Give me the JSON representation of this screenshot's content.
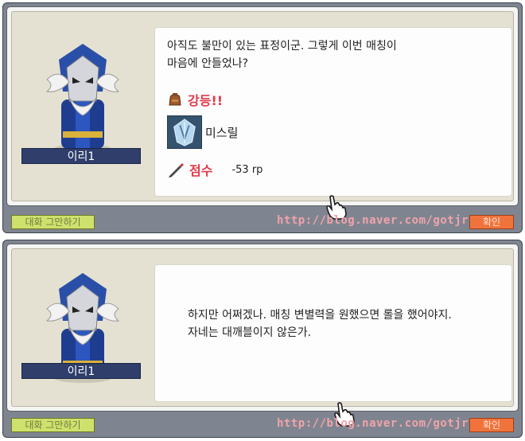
{
  "watermark": "http://blog.naver.com/gotjr",
  "dialogs": [
    {
      "npc_name": "이리1",
      "message_lines": [
        "아직도 불만이 있는 표정이군. 그렇게 이번 매칭이",
        "마음에 안들었나?"
      ],
      "grade_label": "강등!!",
      "tier_name": "미스릴",
      "score_label": "점수",
      "score_value": "-53 rp",
      "end_button": "대화 그만하기",
      "next_button": "확인"
    },
    {
      "npc_name": "이리1",
      "message_lines": [
        "하지만 어쩌겠나. 매칭 변별력을 원했으면 롤을 했어야지.",
        "자네는 대깨블이지 않은가."
      ],
      "end_button": "대화 그만하기",
      "next_button": "확인"
    }
  ],
  "icons": {
    "grade": "bag-icon",
    "tier": "mithril-tier-icon",
    "score": "pen-icon",
    "cursor": "hand-cursor-icon"
  }
}
